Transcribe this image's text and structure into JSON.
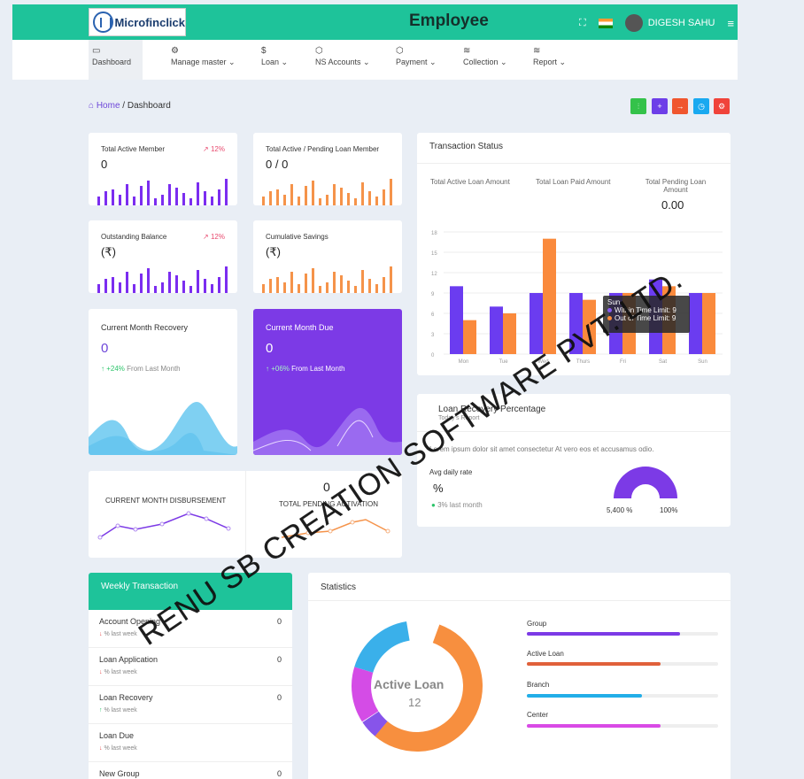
{
  "header": {
    "logo_text": "Microfinclick",
    "page_title": "Employee",
    "user_name": "DIGESH SAHU",
    "brand_color": "#1ec39a"
  },
  "nav": [
    {
      "label": "Dashboard",
      "icon": "monitor-icon"
    },
    {
      "label": "Manage master ⌄",
      "icon": "settings-icon"
    },
    {
      "label": "Loan ⌄",
      "icon": "dollar-icon"
    },
    {
      "label": "NS Accounts ⌄",
      "icon": "box-icon"
    },
    {
      "label": "Payment ⌄",
      "icon": "box-icon"
    },
    {
      "label": "Collection ⌄",
      "icon": "layers-icon"
    },
    {
      "label": "Report ⌄",
      "icon": "layers-icon"
    }
  ],
  "breadcrumb": {
    "home": "Home",
    "sep": "/",
    "current": "Dashboard"
  },
  "quick_buttons": [
    "#34c24a",
    "#6d3ee8",
    "#f0562e",
    "#19a9f0",
    "#f0433a"
  ],
  "cards": {
    "active_member": {
      "label": "Total Active Member",
      "value": "0",
      "trend": "12%"
    },
    "loan_member": {
      "label": "Total Active / Pending Loan Member",
      "value": "0 / 0"
    },
    "outstanding": {
      "label": "Outstanding Balance",
      "value": "(₹)",
      "trend": "12%"
    },
    "savings": {
      "label": "Cumulative Savings",
      "value": "(₹)"
    },
    "recovery": {
      "label": "Current Month Recovery",
      "value": "0",
      "change": "+24%",
      "note": "From Last Month"
    },
    "due": {
      "label": "Current Month Due",
      "value": "0",
      "change": "+06%",
      "note": "From Last Month"
    },
    "disbursement": {
      "label": "CURRENT MONTH DISBURSEMENT",
      "value": "0"
    },
    "activation": {
      "label": "TOTAL PENDING ACTIVATION"
    }
  },
  "transaction_status": {
    "title": "Transaction Status",
    "col1": "Total Active Loan Amount",
    "col2": "Total Loan Paid Amount",
    "col3": "Total Pending Loan Amount",
    "col3_value": "0.00",
    "tooltip_day": "Sun",
    "tooltip_a": "Within Time Limit: 9",
    "tooltip_b": "Out of Time Limit: 9"
  },
  "chart_data": {
    "type": "bar",
    "categories": [
      "Mon",
      "Tue",
      "Wed",
      "Thurs",
      "Fri",
      "Sat",
      "Sun"
    ],
    "series": [
      {
        "name": "Within Time Limit",
        "values": [
          10,
          7,
          9,
          9,
          9,
          11,
          9
        ],
        "color": "#6b3cf0"
      },
      {
        "name": "Out of Time Limit",
        "values": [
          5,
          6,
          17,
          8,
          9,
          10,
          9
        ],
        "color": "#fa8a3c"
      }
    ],
    "yticks": [
      "0",
      "3",
      "6",
      "9",
      "12",
      "15",
      "18"
    ],
    "ylim": [
      0,
      18
    ]
  },
  "recovery_pct": {
    "title": "Loan Recovery Percentage",
    "subtitle": "Today's Report",
    "desc": "Lorem ipsum dolor sit amet consectetur At vero eos et accusamus odio.",
    "avg_label": "Avg daily rate",
    "avg_value": "%",
    "change": "3% last month",
    "gauge_left": "5,400 %",
    "gauge_right": "100%"
  },
  "weekly": {
    "title": "Weekly Transaction",
    "rows": [
      {
        "label": "Account Opening",
        "value": "0",
        "sub": "% last week",
        "dir": "down"
      },
      {
        "label": "Loan Application",
        "value": "0",
        "sub": "% last week",
        "dir": "down"
      },
      {
        "label": "Loan Recovery",
        "value": "0",
        "sub": "% last week",
        "dir": "up"
      },
      {
        "label": "Loan Due",
        "value": "",
        "sub": "% last week",
        "dir": "down"
      },
      {
        "label": "New Group",
        "value": "0",
        "sub": "",
        "dir": ""
      }
    ]
  },
  "statistics": {
    "title": "Statistics",
    "center_label": "Active Loan",
    "center_value": "12",
    "bars": [
      {
        "label": "Group",
        "value": 0.8,
        "color": "#7c3ae6"
      },
      {
        "label": "Active Loan",
        "value": 0.7,
        "color": "#e0603a"
      },
      {
        "label": "Branch",
        "value": 0.6,
        "color": "#22aee8"
      },
      {
        "label": "Center",
        "value": 0.7,
        "color": "#d94ae6"
      }
    ]
  },
  "watermark": "RENU SB CREATION SOFTWARE PVT. LTD."
}
